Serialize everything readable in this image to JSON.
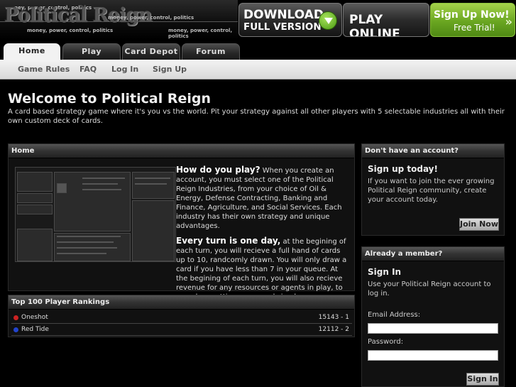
{
  "logo": {
    "name": "Political Reign",
    "tagline": "money, power, control, politics"
  },
  "cta": {
    "download_line1": "DOWNLOAD",
    "download_line2": "FULL VERSION",
    "play_online": "PLAY ONLINE",
    "signup_line1": "Sign Up Now!",
    "signup_line2": "Free Trial!"
  },
  "nav": {
    "tabs": [
      {
        "label": "Home",
        "active": true
      },
      {
        "label": "Play",
        "active": false
      },
      {
        "label": "Card Depot",
        "active": false
      },
      {
        "label": "Forum",
        "active": false
      }
    ],
    "sub_links": [
      "Game Rules",
      "FAQ",
      "Log In",
      "Sign Up"
    ]
  },
  "welcome": {
    "title": "Welcome to Political Reign",
    "text": "A card based strategy game where it's you vs the world. Pit your strategy against all other players with 5 selectable industries all with their own custom deck of cards."
  },
  "home_panel": {
    "title": "Home",
    "how_heading": "How do you play?",
    "how_text": " When you create an account, you must select one of the Political Reign Industries, from your choice of Oil & Energy, Defense Contracting, Banking and Finance, Agriculture, and Social Services. Each industry has their own strategy and unique advantages.",
    "turn_heading": "Every turn is one day,",
    "turn_text": " at the begining of each turn, you will recieve a full hand of cards up to 10, randcomly drawn. You will only draw a card if you have less than 7 in your queue. At the begining of each turn, you will also recieve revenue for any resources or agents in play, to spend on putting more cards in play."
  },
  "rankings": {
    "title": "Top 100 Player Rankings",
    "rows": [
      {
        "name": "Oneshot",
        "score": "15143 - 1",
        "color": "#cc2222"
      },
      {
        "name": "Red Tide",
        "score": "12112 - 2",
        "color": "#2244cc"
      }
    ]
  },
  "signup_panel": {
    "title": "Don't have an account?",
    "heading": "Sign up today!",
    "text": "If you want to join the ever growing Political Reign community, create your account today.",
    "button": "Join Now"
  },
  "member_panel": {
    "title": "Already a member?",
    "heading": "Sign In",
    "text": "Use your Political Reign account to log in.",
    "email_label": "Email Address:",
    "password_label": "Password:",
    "button": "Sign In"
  }
}
